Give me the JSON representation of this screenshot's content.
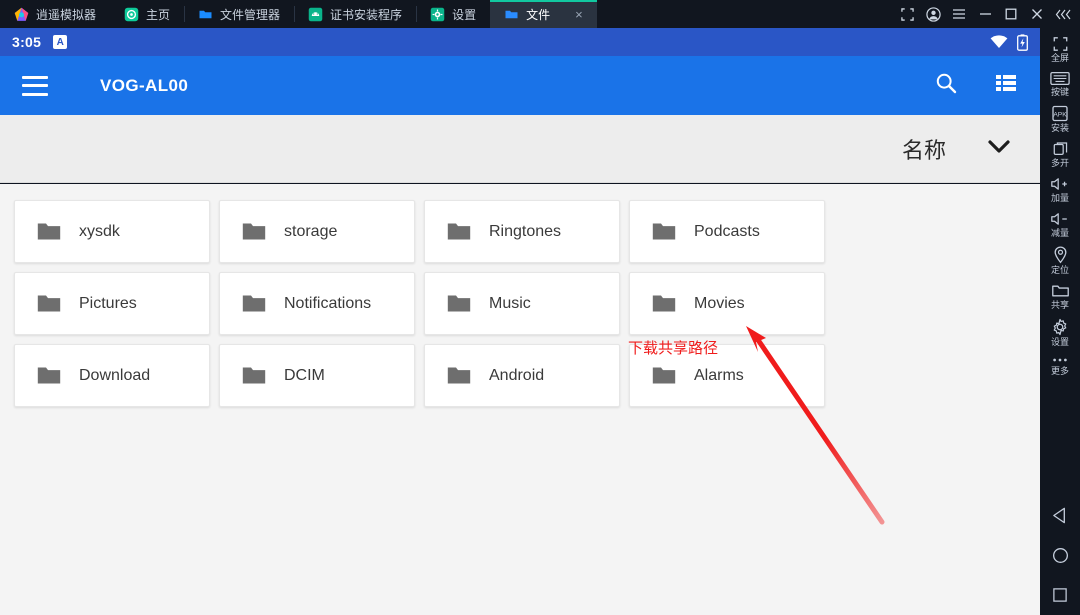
{
  "window": {
    "tabs": [
      {
        "label": "逍遥模拟器",
        "icon": "app-logo-icon",
        "active": false,
        "closable": false
      },
      {
        "label": "主页",
        "icon": "home-circle-icon",
        "active": false,
        "closable": false
      },
      {
        "label": "文件管理器",
        "icon": "folder-blue-icon",
        "active": false,
        "closable": false
      },
      {
        "label": "证书安装程序",
        "icon": "android-green-icon",
        "active": false,
        "closable": false
      },
      {
        "label": "设置",
        "icon": "gear-green-icon",
        "active": false,
        "closable": false
      },
      {
        "label": "文件",
        "icon": "folder-blue-icon",
        "active": true,
        "closable": true
      }
    ],
    "close_glyph": "×",
    "controls": [
      {
        "name": "screenshot-button",
        "glyph": "crop"
      },
      {
        "name": "account-button",
        "glyph": "user"
      },
      {
        "name": "menu-button",
        "glyph": "hamburger"
      },
      {
        "name": "minimize-button",
        "glyph": "minimize"
      },
      {
        "name": "maximize-button",
        "glyph": "maximize"
      },
      {
        "name": "close-button",
        "glyph": "close"
      },
      {
        "name": "collapse-button",
        "glyph": "chevrons-left"
      }
    ]
  },
  "statusbar": {
    "time": "3:05",
    "badge": "A",
    "wifi_icon": "wifi-icon",
    "battery_icon": "battery-charging-icon"
  },
  "appbar": {
    "menu_icon": "hamburger-icon",
    "title": "VOG-AL00",
    "search_icon": "search-icon",
    "view_icon": "list-view-icon"
  },
  "sortbar": {
    "label": "名称",
    "chevron_icon": "chevron-down-icon"
  },
  "files": [
    {
      "name": "xysdk",
      "icon": "folder-icon"
    },
    {
      "name": "storage",
      "icon": "folder-icon"
    },
    {
      "name": "Ringtones",
      "icon": "folder-icon"
    },
    {
      "name": "Podcasts",
      "icon": "folder-icon"
    },
    {
      "name": "Pictures",
      "icon": "folder-icon"
    },
    {
      "name": "Notifications",
      "icon": "folder-icon"
    },
    {
      "name": "Music",
      "icon": "folder-icon"
    },
    {
      "name": "Movies",
      "icon": "folder-icon"
    },
    {
      "name": "Download",
      "icon": "folder-icon"
    },
    {
      "name": "DCIM",
      "icon": "folder-icon"
    },
    {
      "name": "Android",
      "icon": "folder-icon"
    },
    {
      "name": "Alarms",
      "icon": "folder-icon"
    }
  ],
  "annotation": {
    "text": "下载共享路径",
    "color": "#f01c1c",
    "points_to": "Download"
  },
  "sidebar": {
    "items": [
      {
        "label": "全屏",
        "icon": "fullscreen-icon"
      },
      {
        "label": "按键",
        "icon": "keyboard-icon"
      },
      {
        "label": "安装",
        "icon": "apk-install-icon"
      },
      {
        "label": "多开",
        "icon": "multi-instance-icon"
      },
      {
        "label": "加量",
        "icon": "volume-up-icon"
      },
      {
        "label": "减量",
        "icon": "volume-down-icon"
      },
      {
        "label": "定位",
        "icon": "location-pin-icon"
      },
      {
        "label": "共享",
        "icon": "shared-folder-icon"
      },
      {
        "label": "设置",
        "icon": "gear-icon"
      },
      {
        "label": "更多",
        "icon": "more-dots-icon"
      }
    ],
    "nav": [
      {
        "name": "back-button",
        "icon": "triangle-back-icon"
      },
      {
        "name": "home-button",
        "icon": "circle-home-icon"
      },
      {
        "name": "recents-button",
        "icon": "square-recents-icon"
      }
    ]
  },
  "colors": {
    "appbar": "#1a73e8",
    "statusbar": "#2a56c6",
    "chrome": "#11161f",
    "active_tab_accent": "#12c8a0",
    "annotation": "#f01c1c"
  }
}
